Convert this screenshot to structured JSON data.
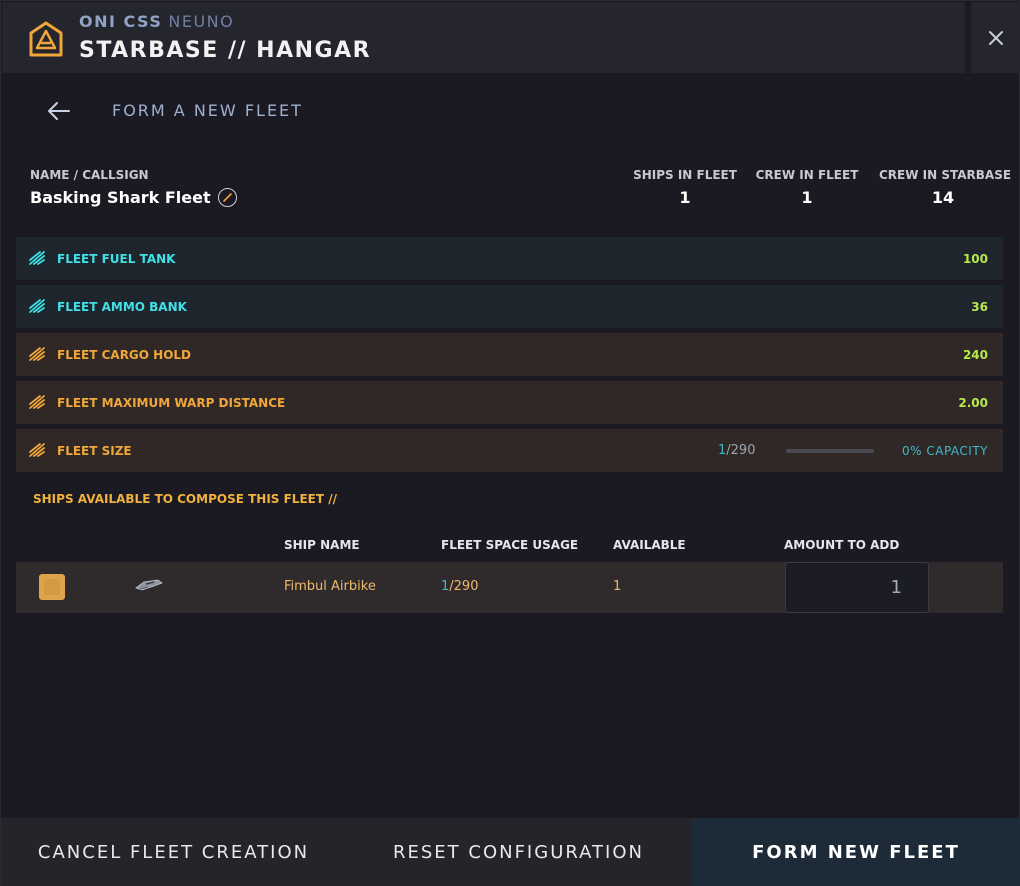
{
  "header": {
    "org": "ONI CSS",
    "person": "NEUNO",
    "title": "STARBASE // HANGAR"
  },
  "form": {
    "title": "FORM A NEW FLEET"
  },
  "fleet": {
    "name_label": "NAME / CALLSIGN",
    "name": "Basking Shark Fleet"
  },
  "stats": [
    {
      "label": "SHIPS IN FLEET",
      "value": "1"
    },
    {
      "label": "CREW IN FLEET",
      "value": "1"
    },
    {
      "label": "CREW IN STARBASE",
      "value": "14"
    }
  ],
  "attributes": [
    {
      "label": "FLEET FUEL TANK",
      "value": "100",
      "tone": "blue"
    },
    {
      "label": "FLEET AMMO BANK",
      "value": "36",
      "tone": "blue"
    },
    {
      "label": "FLEET CARGO HOLD",
      "value": "240",
      "tone": "orange"
    },
    {
      "label": "FLEET MAXIMUM WARP DISTANCE",
      "value": "2.00",
      "tone": "orange"
    }
  ],
  "fleet_size": {
    "label": "FLEET SIZE",
    "current": "1",
    "max": "/290",
    "capacity_fraction": 0.0,
    "capacity_label": "0% CAPACITY"
  },
  "ships": {
    "title": "SHIPS AVAILABLE TO COMPOSE THIS FLEET //",
    "columns": {
      "name": "SHIP NAME",
      "usage": "FLEET SPACE USAGE",
      "available": "AVAILABLE",
      "amount": "AMOUNT TO ADD"
    },
    "rows": [
      {
        "name": "Fimbul Airbike",
        "usage_current": "1",
        "usage_max": "/290",
        "available": "1",
        "amount": "1"
      }
    ]
  },
  "footer": {
    "cancel": "CANCEL FLEET CREATION",
    "reset": "RESET CONFIGURATION",
    "form": "FORM NEW FLEET"
  },
  "colors": {
    "accent_blue": "#3fe0e8",
    "accent_orange": "#f0a63a",
    "value_green": "#b6ea4c",
    "capacity_teal": "#3fb9c8"
  },
  "icons": {
    "logo": "starbase-logo-icon",
    "close": "close-icon",
    "back": "arrow-left-icon",
    "edit": "pencil-icon",
    "attribute": "ship-thrust-icon"
  }
}
